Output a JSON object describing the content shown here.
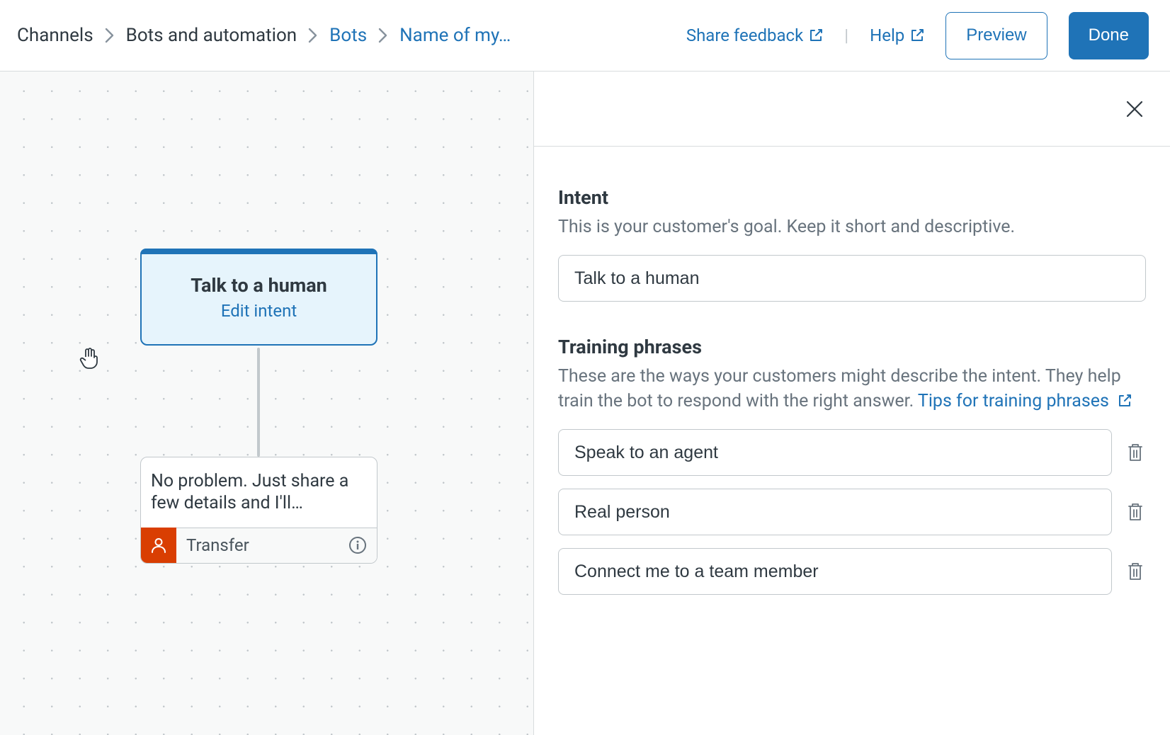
{
  "breadcrumb": {
    "channels": "Channels",
    "bots_auto": "Bots and automation",
    "bots": "Bots",
    "current": "Name of my…"
  },
  "header": {
    "share_feedback": "Share feedback",
    "help": "Help",
    "preview": "Preview",
    "done": "Done"
  },
  "canvas": {
    "intent_title": "Talk to a human",
    "edit_intent": "Edit intent",
    "msg_text": "No problem. Just share a few details and I'll…",
    "transfer": "Transfer"
  },
  "panel": {
    "intent_heading": "Intent",
    "intent_desc": "This is your customer's goal. Keep it short and descriptive.",
    "intent_value": "Talk to a human",
    "phrases_heading": "Training phrases",
    "phrases_desc_1": "These are the ways your customers might describe the intent. They help train the bot to respond with the right answer. ",
    "phrases_tips": "Tips for training phrases",
    "phrases": [
      "Speak to an agent",
      "Real person",
      "Connect me to a team member"
    ]
  }
}
